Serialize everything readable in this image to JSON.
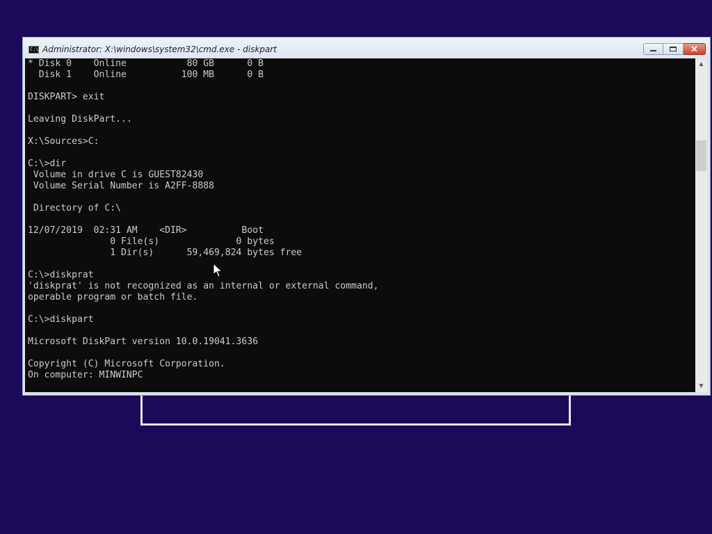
{
  "window": {
    "title": "Administrator: X:\\windows\\system32\\cmd.exe - diskpart",
    "icon": "cmd-icon",
    "buttons": {
      "minimize": "minimize-icon",
      "maximize": "maximize-icon",
      "close": "close-icon",
      "close_glyph": "✕"
    }
  },
  "console": {
    "lines": [
      "* Disk 0    Online           80 GB      0 B",
      "  Disk 1    Online          100 MB      0 B",
      "",
      "DISKPART> exit",
      "",
      "Leaving DiskPart...",
      "",
      "X:\\Sources>C:",
      "",
      "C:\\>dir",
      " Volume in drive C is GUEST82430",
      " Volume Serial Number is A2FF-8888",
      "",
      " Directory of C:\\",
      "",
      "12/07/2019  02:31 AM    <DIR>          Boot",
      "               0 File(s)              0 bytes",
      "               1 Dir(s)      59,469,824 bytes free",
      "",
      "C:\\>diskprat",
      "'diskprat' is not recognized as an internal or external command,",
      "operable program or batch file.",
      "",
      "C:\\>diskpart",
      "",
      "Microsoft DiskPart version 10.0.19041.3636",
      "",
      "Copyright (C) Microsoft Corporation.",
      "On computer: MINWINPC"
    ]
  },
  "scrollbar": {
    "up_glyph": "▲",
    "down_glyph": "▼"
  }
}
